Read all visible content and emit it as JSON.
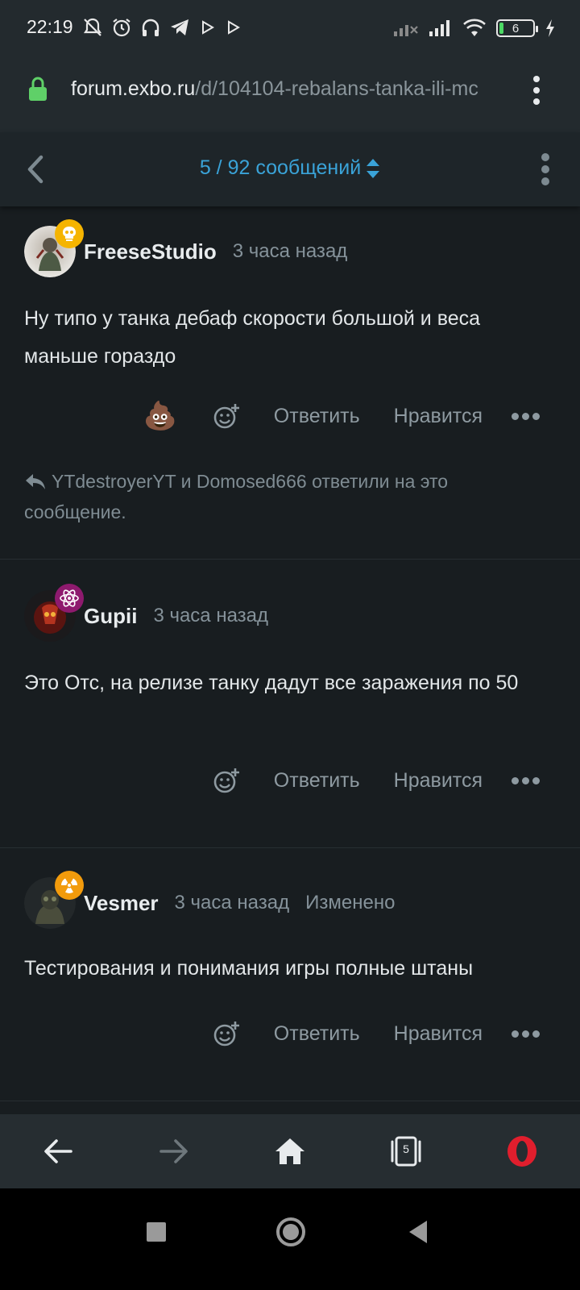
{
  "status_bar": {
    "time": "22:19",
    "battery_level": "6",
    "icons": [
      "mute-icon",
      "alarm-icon",
      "headphones-icon",
      "telegram-icon",
      "play-icon",
      "play-icon",
      "signal-icon",
      "signal-icon",
      "wifi-icon",
      "battery-icon",
      "charging-icon"
    ]
  },
  "browser": {
    "url_host": "forum.exbo.ru",
    "url_path": "/d/104104-rebalans-tanka-ili-mc"
  },
  "forum_header": {
    "scrubber_text": "5 / 92 сообщений"
  },
  "posts": [
    {
      "username": "FreeseStudio",
      "time": "3 часа назад",
      "edited": "",
      "body": "Ну типо у танка дебаф скорости большой и веса маньше гораздо",
      "reaction": "💩",
      "reply_label": "Ответить",
      "like_label": "Нравится",
      "replied_text": "YTdestroyerYT и Domosed666 ответили на это сообщение.",
      "badge_color": "#f5b400",
      "badge_icon": "skull-icon"
    },
    {
      "username": "Gupii",
      "time": "3 часа назад",
      "edited": "",
      "body": "Это Отс, на релизе танку дадут все заражения по 50",
      "reply_label": "Ответить",
      "like_label": "Нравится",
      "badge_color": "#8e1a6e",
      "badge_icon": "atom-icon"
    },
    {
      "username": "Vesmer",
      "time": "3 часа назад",
      "edited": "Изменено",
      "body": "Тестирования и понимания игры полные штаны",
      "reply_label": "Ответить",
      "like_label": "Нравится",
      "badge_color": "#f29b0c",
      "badge_icon": "radiation-icon"
    }
  ],
  "bottom_nav": {
    "tab_count": "5",
    "icons": [
      "back-arrow-icon",
      "forward-arrow-icon",
      "home-icon",
      "tabs-icon",
      "opera-icon"
    ]
  },
  "colors": {
    "accent": "#3aa3d8",
    "background": "#181d20",
    "header": "#1e2529",
    "opera": "#e01e2d"
  }
}
